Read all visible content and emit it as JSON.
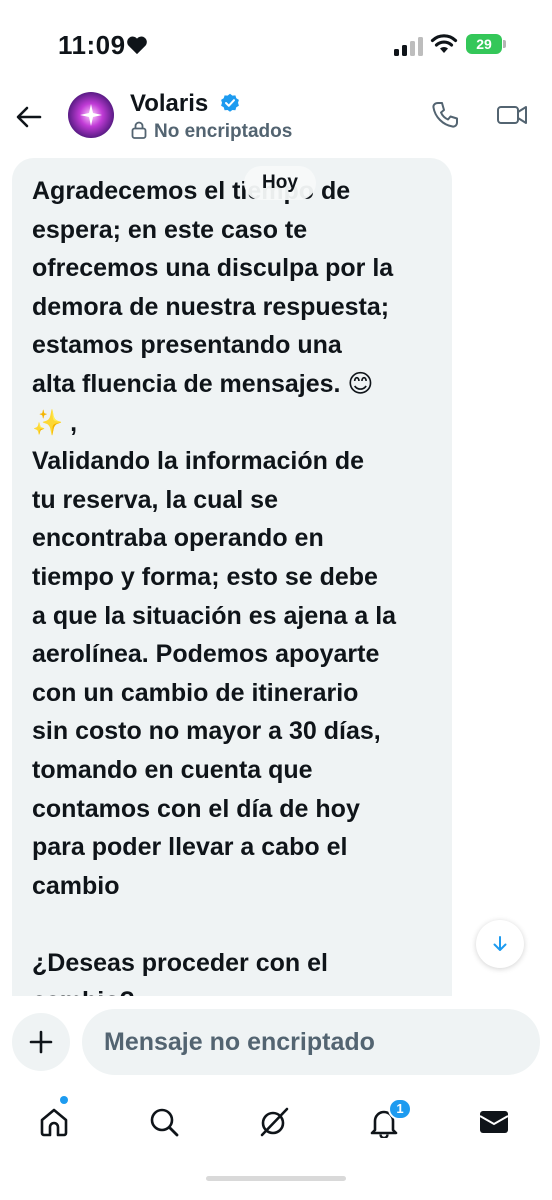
{
  "status_bar": {
    "time": "11:09",
    "battery_percent": "29",
    "icons": [
      "heart-icon",
      "cellular-signal-icon",
      "wifi-icon",
      "battery-charging-icon"
    ]
  },
  "header": {
    "contact_name": "Volaris",
    "verified": true,
    "encryption_status": "No encriptados",
    "icons": [
      "back-arrow-icon",
      "verified-badge-icon",
      "lock-icon",
      "phone-icon",
      "video-camera-icon"
    ]
  },
  "chat": {
    "date_separator": "Hoy",
    "message_lines": [
      "Agradecemos el tiempo de",
      "espera; en este caso te",
      "ofrecemos una disculpa por la",
      "demora de nuestra respuesta;",
      "estamos presentando una",
      "alta fluencia de mensajes. 😊",
      "✨ ,",
      "Validando la información de",
      "tu reserva, la cual se",
      "encontraba operando en",
      "tiempo y forma; esto se debe",
      "a que la situación es ajena a la",
      "aerolínea. Podemos apoyarte",
      "con un cambio de itinerario",
      "sin costo no mayor a 30 días,",
      "tomando en cuenta que",
      "contamos con el día de hoy",
      "para poder llevar a cabo el",
      "cambio",
      "",
      "¿Deseas proceder con el",
      "cambio?"
    ]
  },
  "composer": {
    "placeholder": "Mensaje no encriptado"
  },
  "bottom_nav": {
    "items": [
      "home",
      "search",
      "grok",
      "notifications",
      "messages"
    ],
    "notifications_badge": "1"
  },
  "colors": {
    "accent": "#1d9bf0",
    "bubble": "#eff3f4",
    "text": "#0f1419",
    "secondary_text": "#536471",
    "battery": "#34c759"
  }
}
